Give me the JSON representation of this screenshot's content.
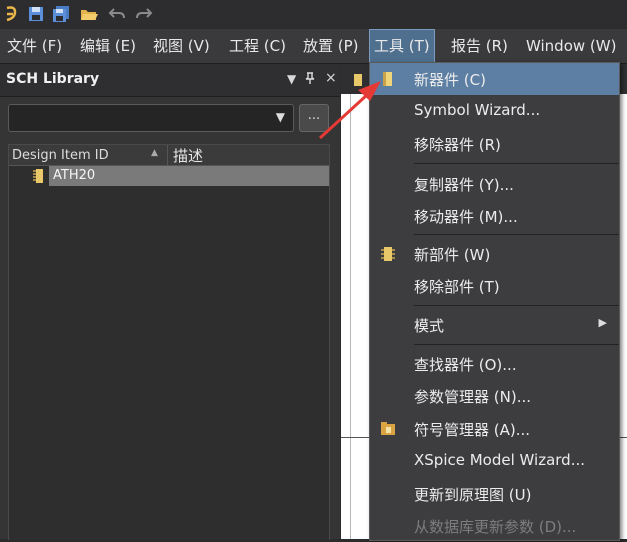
{
  "quick_access": {
    "icons": [
      "logo-icon",
      "save-icon",
      "save-all-icon",
      "open-folder-icon",
      "undo-icon",
      "redo-icon"
    ]
  },
  "menubar": {
    "items": [
      {
        "label": "文件 (F)"
      },
      {
        "label": "编辑 (E)"
      },
      {
        "label": "视图 (V)"
      },
      {
        "label": "工程 (C)"
      },
      {
        "label": "放置 (P)"
      },
      {
        "label": "工具 (T)",
        "active": true
      },
      {
        "label": "报告 (R)"
      },
      {
        "label": "Window (W)"
      }
    ]
  },
  "panel": {
    "title": "SCH Library",
    "dropdown_value": "",
    "browse_label": "...",
    "columns": [
      "Design Item ID",
      "描述"
    ],
    "rows": [
      {
        "id": "ATH20",
        "desc": ""
      }
    ]
  },
  "tools_menu": {
    "items": [
      {
        "label": "新器件 (C)",
        "icon": "component-icon",
        "highlighted": true
      },
      {
        "label": "Symbol Wizard..."
      },
      {
        "label": "移除器件 (R)"
      },
      {
        "label": "复制器件 (Y)..."
      },
      {
        "label": "移动器件 (M)..."
      },
      {
        "label": "新部件 (W)",
        "icon": "part-icon"
      },
      {
        "label": "移除部件 (T)"
      },
      {
        "label": "模式",
        "submenu": true
      },
      {
        "label": "查找器件 (O)..."
      },
      {
        "label": "参数管理器 (N)..."
      },
      {
        "label": "符号管理器 (A)...",
        "icon": "symbol-manager-icon"
      },
      {
        "label": "XSpice Model Wizard..."
      },
      {
        "label": "更新到原理图 (U)"
      },
      {
        "label": "从数据库更新参数 (D)...",
        "disabled": true
      }
    ]
  },
  "colors": {
    "menu_highlight": "#5d7fa3",
    "annotation_arrow": "#e53935",
    "component_icon": "#e9c86a"
  }
}
